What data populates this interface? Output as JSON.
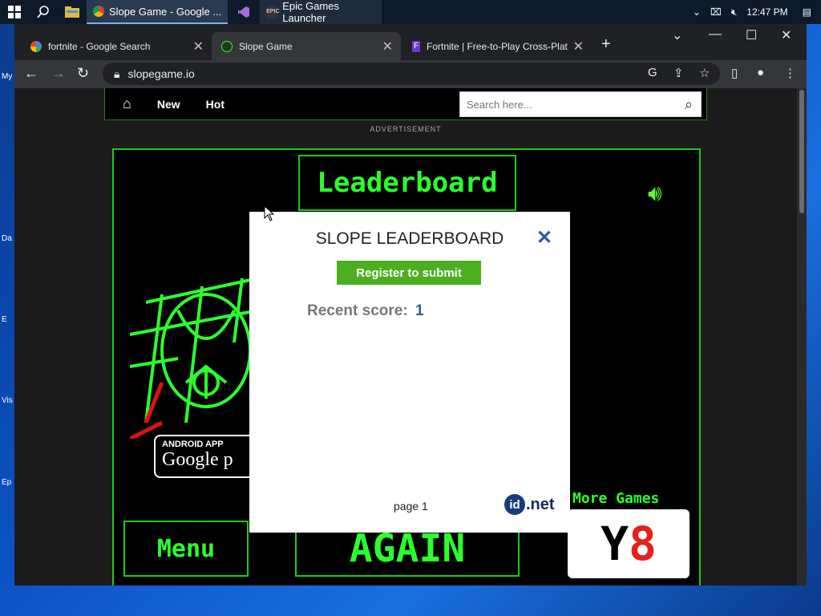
{
  "taskbar": {
    "apps": [
      {
        "label": "Slope Game - Google ...",
        "active": true
      },
      {
        "label": "Epic Games Launcher",
        "active": false
      }
    ],
    "time": "12:47 PM"
  },
  "desktop": {
    "labels": [
      "My",
      "Da",
      "E",
      "Vis",
      "Ep"
    ]
  },
  "browser": {
    "tabs": [
      {
        "title": "fortnite - Google Search"
      },
      {
        "title": "Slope Game"
      },
      {
        "title": "Fortnite | Free-to-Play Cross-Plat"
      }
    ],
    "url": "slopegame.io"
  },
  "site": {
    "nav": {
      "new": "New",
      "hot": "Hot"
    },
    "search_placeholder": "Search here...",
    "advertisement": "ADVERTISEMENT"
  },
  "game": {
    "leaderboard_title": "Leaderboard",
    "android_small": "ANDROID APP",
    "android_big": "Google p",
    "more_games": "More Games",
    "y8_y": "Y",
    "y8_8": "8",
    "menu": "Menu",
    "again": "AGAIN"
  },
  "modal": {
    "title": "SLOPE LEADERBOARD",
    "close": "✕",
    "register": "Register to submit",
    "recent_label": "Recent score:",
    "recent_value": "1",
    "page": "page 1",
    "idnet_id": "id",
    "idnet_net": ".net"
  }
}
